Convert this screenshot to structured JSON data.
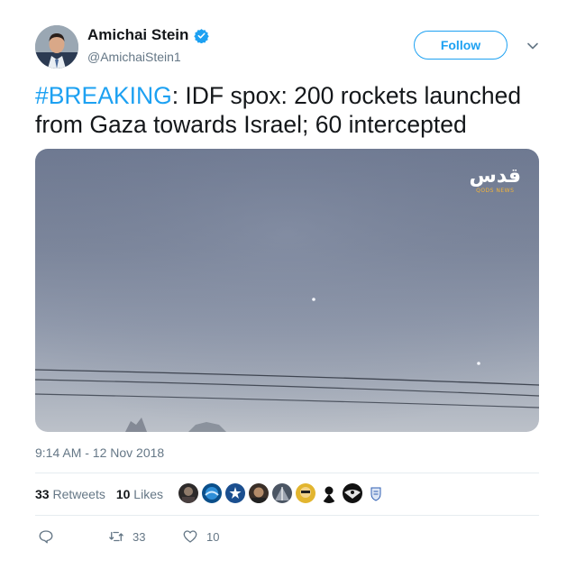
{
  "author": {
    "name": "Amichai Stein",
    "handle": "@AmichaiStein1",
    "verified": true,
    "avatar_icon": "profile-photo"
  },
  "follow_button": {
    "label": "Follow"
  },
  "tweet": {
    "hashtag": "#BREAKING",
    "text_after_hashtag": ": IDF spox: 200 rockets launched from Gaza towards Israel; 60 intercepted",
    "timestamp": "9:14 AM - 12 Nov 2018"
  },
  "media": {
    "channel_logo_text": "قدس",
    "channel_logo_subtext": "QODS NEWS"
  },
  "stats": {
    "retweets_count": "33",
    "retweets_label": "Retweets",
    "likes_count": "10",
    "likes_label": "Likes",
    "liker_avatars": [
      "liker-1",
      "liker-2",
      "liker-3",
      "liker-4",
      "liker-5",
      "liker-6",
      "liker-7",
      "liker-8",
      "liker-9"
    ]
  },
  "actions": {
    "reply_count": "",
    "retweet_count": "33",
    "like_count": "10"
  },
  "colors": {
    "accent": "#1da1f2",
    "secondary_text": "#657786",
    "divider": "#e6ecf0"
  }
}
